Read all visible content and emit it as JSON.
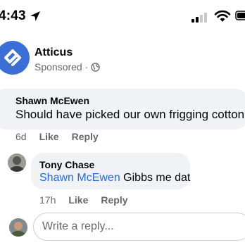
{
  "status_bar": {
    "time": "4:43",
    "icons": [
      "location-arrow-icon",
      "signal-icon",
      "wifi-icon",
      "battery-icon"
    ]
  },
  "post": {
    "page_name": "Atticus",
    "sponsored_label": "Sponsored · ",
    "logo_icon": "atticus-logo-icon",
    "privacy_icon": "globe-icon"
  },
  "comments": [
    {
      "author": "Shawn McEwen",
      "text": "Should have picked our own frigging cotton",
      "age": "6d",
      "like_label": "Like",
      "reply_label": "Reply",
      "reply": {
        "author": "Tony Chase",
        "mention": "Shawn McEwen",
        "text": " Gibbs me dat",
        "age": "17h",
        "like_label": "Like",
        "reply_label": "Reply"
      }
    }
  ],
  "composer": {
    "placeholder": "Write a reply...",
    "value": ""
  },
  "colors": {
    "brand": "#3b6fd6",
    "link": "#216fdb",
    "bubble": "#f0f2f5",
    "secondary_text": "#65676b"
  }
}
